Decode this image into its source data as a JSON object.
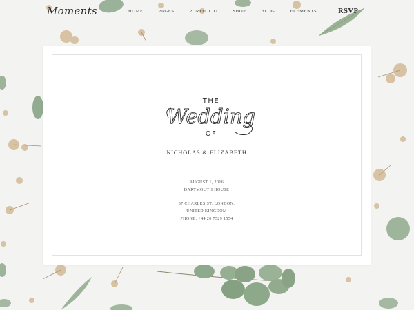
{
  "brand": {
    "logo_text": "Moments"
  },
  "nav": {
    "items": [
      {
        "label": "HOME"
      },
      {
        "label": "PAGES"
      },
      {
        "label": "PORTFOLIO"
      },
      {
        "label": "SHOP"
      },
      {
        "label": "BLOG"
      },
      {
        "label": "ELEMENTS"
      }
    ],
    "cta_label": "RSVP"
  },
  "card": {
    "title_top": "THE",
    "title_main": "Wedding",
    "title_bottom": "OF",
    "couple": "NICHOLAS & ELIZABETH",
    "date": "AUGUST 1, 2016",
    "venue": "DARTMOUTH HOUSE",
    "address_line1": "37 CHARLES ST, LONDON,",
    "address_line2": "UNITED KINGDOM",
    "phone": "PHONE: +44 20 7529 1554"
  },
  "colors": {
    "background": "#f3f3f1",
    "leaf": "#8aa48a",
    "flower": "#d9c3a5",
    "text": "#333333"
  }
}
